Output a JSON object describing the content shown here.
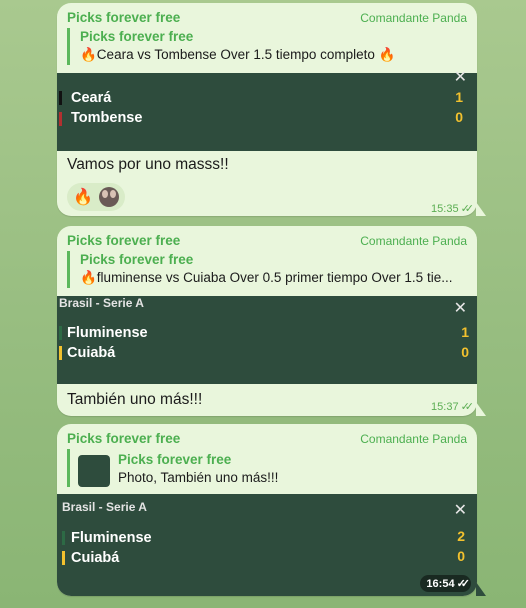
{
  "messages": [
    {
      "sender": "Picks forever free",
      "author": "Comandante Panda",
      "reply": {
        "title": "Picks forever free",
        "text": "🔥Ceara vs Tombense Over 1.5 tiempo completo 🔥"
      },
      "score": {
        "league": "",
        "home": "Ceará",
        "away": "Tombense",
        "home_score": "1",
        "away_score": "0",
        "home_color": "#111111",
        "away_color": "#b23030"
      },
      "text": "Vamos por uno masss!!",
      "reactions": [
        "🔥"
      ],
      "time": "15:35"
    },
    {
      "sender": "Picks forever free",
      "author": "Comandante Panda",
      "reply": {
        "title": "Picks forever free",
        "text": "🔥fluminense vs Cuiaba Over 0.5 primer tiempo Over 1.5 tie..."
      },
      "score": {
        "league": "Brasil - Serie A",
        "home": "Fluminense",
        "away": "Cuiabá",
        "home_score": "1",
        "away_score": "0",
        "home_color": "#2d6a45",
        "away_color": "#f2c12e"
      },
      "text": "También uno más!!!",
      "time": "15:37"
    },
    {
      "sender": "Picks forever free",
      "author": "Comandante Panda",
      "reply": {
        "title": "Picks forever free",
        "text": "Photo, También uno más!!!"
      },
      "score": {
        "league": "Brasil - Serie A",
        "home": "Fluminense",
        "away": "Cuiabá",
        "home_score": "2",
        "away_score": "0",
        "home_color": "#2d6a45",
        "away_color": "#f2c12e"
      },
      "time": "16:54"
    }
  ],
  "icons": {
    "close": "close-icon",
    "read": "double-check-icon",
    "fire": "fire-emoji",
    "avatar": "avatar"
  }
}
